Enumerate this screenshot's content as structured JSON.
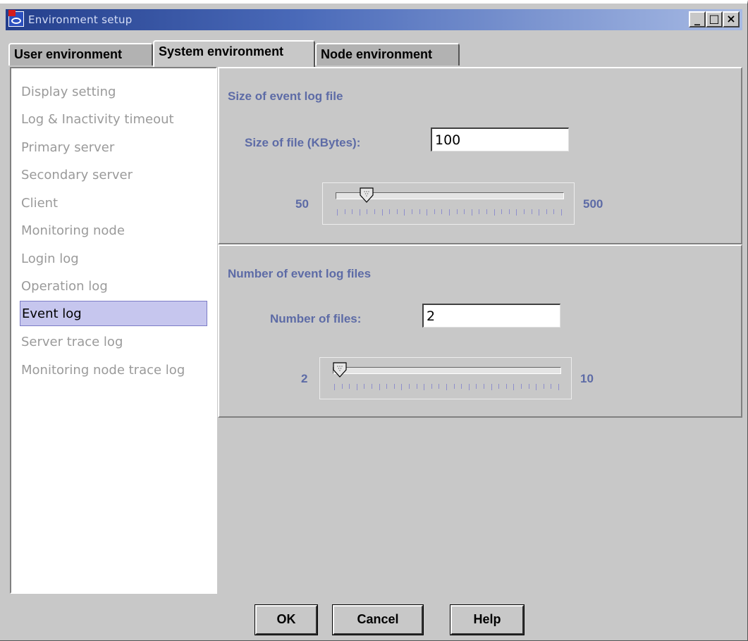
{
  "window": {
    "title": "Environment setup",
    "controls": {
      "minimize": "_",
      "maximize": "□",
      "close": "×"
    }
  },
  "tabs": [
    {
      "label": "User environment",
      "active": false
    },
    {
      "label": "System environment",
      "active": true
    },
    {
      "label": "Node environment",
      "active": false
    }
  ],
  "nav": {
    "items": [
      {
        "label": "Display setting",
        "selected": false
      },
      {
        "label": "Log & Inactivity timeout",
        "selected": false
      },
      {
        "label": "Primary server",
        "selected": false
      },
      {
        "label": "Secondary server",
        "selected": false
      },
      {
        "label": "Client",
        "selected": false
      },
      {
        "label": "Monitoring node",
        "selected": false
      },
      {
        "label": "Login log",
        "selected": false
      },
      {
        "label": "Operation log",
        "selected": false
      },
      {
        "label": "Event log",
        "selected": true
      },
      {
        "label": "Server trace log",
        "selected": false
      },
      {
        "label": "Monitoring node trace log",
        "selected": false
      }
    ]
  },
  "size_panel": {
    "title": "Size of event log file",
    "field_label": "Size of file (KBytes):",
    "value": "100",
    "slider": {
      "min": 50,
      "max": 500,
      "value": 100,
      "min_label": "50",
      "max_label": "500"
    }
  },
  "count_panel": {
    "title": "Number of event log files",
    "field_label": "Number of files:",
    "value": "2",
    "slider": {
      "min": 2,
      "max": 10,
      "value": 2,
      "min_label": "2",
      "max_label": "10"
    }
  },
  "buttons": {
    "ok": "OK",
    "cancel": "Cancel",
    "help": "Help"
  },
  "colors": {
    "accent": "#5d6ba6",
    "selection": "#c6c6ee",
    "titlebar": "#243f8c"
  }
}
